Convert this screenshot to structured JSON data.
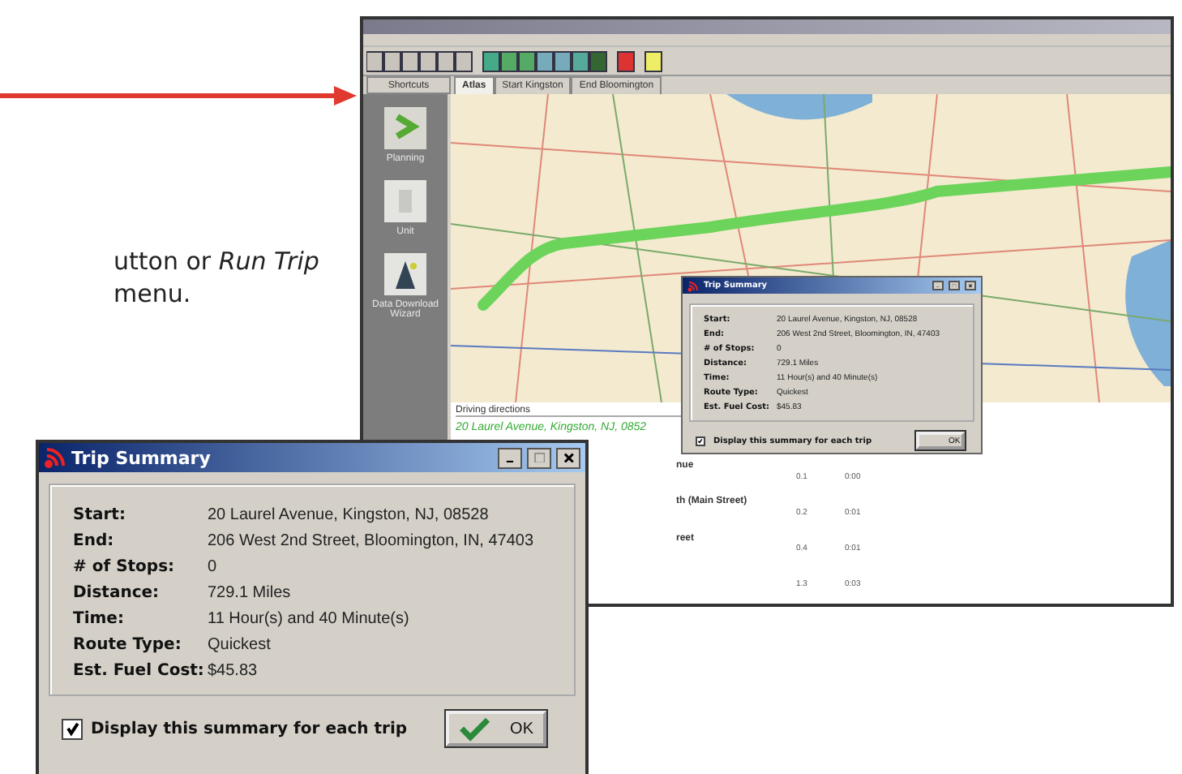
{
  "caption": {
    "lines": [
      "utton or *Run Trip*",
      "menu."
    ]
  },
  "app_window": {
    "shortcuts": "Shortcuts",
    "tabs": [
      {
        "label": "Atlas",
        "selected": true
      },
      {
        "label": "Start Kingston",
        "selected": false
      },
      {
        "label": "End Bloomington",
        "selected": false
      }
    ],
    "sidebar": {
      "items": [
        {
          "label": "Planning",
          "kind": "planning"
        },
        {
          "label": "Unit",
          "kind": "unit"
        },
        {
          "label": "Data Download Wizard",
          "kind": "wizard"
        }
      ]
    },
    "directions": {
      "title": "Driving directions",
      "start": "20 Laurel Avenue, Kingston, NJ, 0852",
      "steps": [
        {
          "text": "nue",
          "distance": "0.1",
          "time": "0:00"
        },
        {
          "text": "th (Main Street)",
          "distance": "0.2",
          "time": "0:01"
        },
        {
          "text": "reet",
          "distance": "0.4",
          "time": "0:01"
        },
        {
          "distance": "1.3",
          "time": "0:03"
        }
      ]
    }
  },
  "dialogs": [
    {
      "title": "Trip Summary",
      "fields": [
        {
          "label": "Start:",
          "value": "20 Laurel Avenue, Kingston, NJ, 08528"
        },
        {
          "label": "End:",
          "value": "206 West 2nd Street, Bloomington, IN, 47403"
        },
        {
          "label": "# of Stops:",
          "value": "0"
        },
        {
          "label": "Distance:",
          "value": "729.1 Miles"
        },
        {
          "label": "Time:",
          "value": "11 Hour(s) and 40 Minute(s)"
        },
        {
          "label": "Route Type:",
          "value": "Quickest"
        },
        {
          "label": "Est. Fuel Cost:",
          "value": "$45.83"
        }
      ],
      "checkbox": {
        "label": "Display this summary for each trip",
        "checked": true
      },
      "ok": "OK"
    },
    {
      "title": "Trip Summary",
      "fields": [
        {
          "label": "Start:",
          "value": "20 Laurel Avenue, Kingston, NJ, 08528"
        },
        {
          "label": "End:",
          "value": "206 West 2nd Street, Bloomington, IN, 47403"
        },
        {
          "label": "# of Stops:",
          "value": "0"
        },
        {
          "label": "Distance:",
          "value": "729.1 Miles"
        },
        {
          "label": "Time:",
          "value": "11 Hour(s) and 40 Minute(s)"
        },
        {
          "label": "Route Type:",
          "value": "Quickest"
        },
        {
          "label": "Est. Fuel Cost:",
          "value": "$45.83"
        }
      ],
      "checkbox": {
        "label": "Display this summary for each trip",
        "checked": true
      },
      "ok": "OK"
    }
  ]
}
